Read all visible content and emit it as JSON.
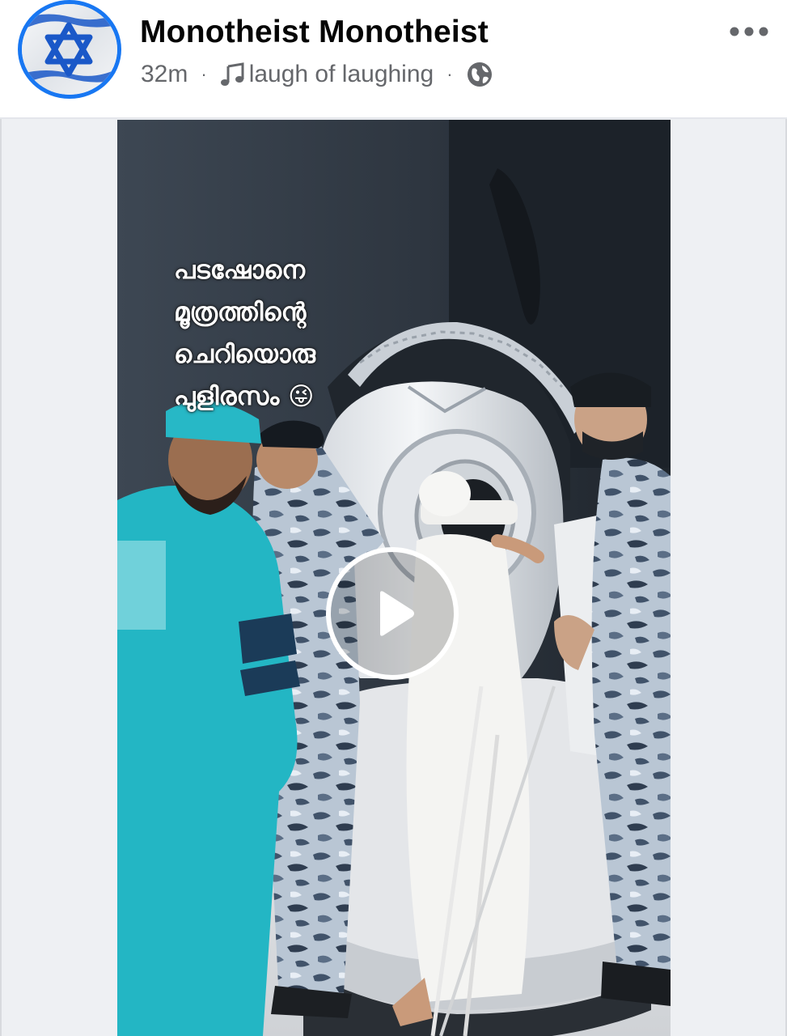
{
  "post": {
    "author": "Monotheist Monotheist",
    "time": "32m",
    "separator": "·",
    "audio_label": "laugh of laughing",
    "audience_icon": "globe-icon",
    "more_icon": "more-horizontal-icon",
    "avatar_icon": "star-of-david-flag-avatar"
  },
  "video": {
    "caption_lines": [
      "പടഷോനെ",
      "മൂത്രത്തിന്റെ",
      "ചെറിയൊരു",
      "പുളിരസം 😜"
    ],
    "play_icon": "play-icon"
  },
  "colors": {
    "accent": "#1877f2",
    "text_primary": "#050505",
    "text_secondary": "#65676b",
    "divider": "#e4e6eb"
  }
}
